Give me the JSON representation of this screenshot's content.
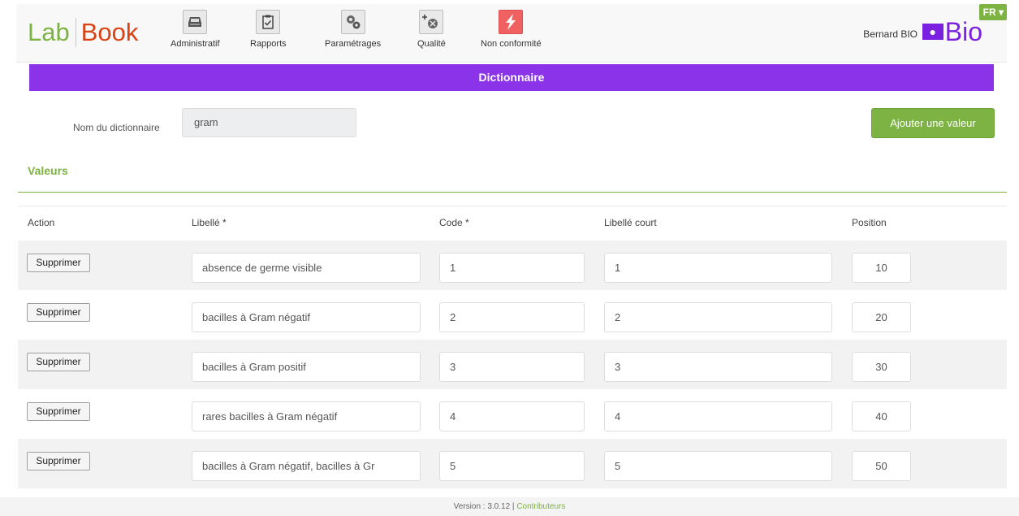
{
  "header": {
    "logo_left": "Lab",
    "logo_right": "Book",
    "nav": [
      {
        "label": "Administratif",
        "icon": "inbox-icon"
      },
      {
        "label": "Rapports",
        "icon": "clipboard-check-icon"
      },
      {
        "label": "Paramétrages",
        "icon": "gears-icon"
      },
      {
        "label": "Qualité",
        "icon": "quality-gear-icon"
      },
      {
        "label": "Non conformité",
        "icon": "lightning-icon"
      }
    ],
    "user_name": "Bernard BIO",
    "bio_logo_text": "Bio",
    "language": "FR"
  },
  "title_bar": "Dictionnaire",
  "form": {
    "dict_name_label": "Nom du dictionnaire",
    "dict_name_value": "gram",
    "add_button": "Ajouter une valeur",
    "section_title": "Valeurs"
  },
  "table": {
    "headers": {
      "action": "Action",
      "libelle": "Libellé *",
      "code": "Code *",
      "libelle_court": "Libellé court",
      "position": "Position"
    },
    "delete_label": "Supprimer",
    "rows": [
      {
        "libelle": "absence de germe visible",
        "code": "1",
        "court": "1",
        "position": "10"
      },
      {
        "libelle": "bacilles à Gram négatif",
        "code": "2",
        "court": "2",
        "position": "20"
      },
      {
        "libelle": "bacilles à Gram positif",
        "code": "3",
        "court": "3",
        "position": "30"
      },
      {
        "libelle": "rares bacilles à Gram négatif",
        "code": "4",
        "court": "4",
        "position": "40"
      },
      {
        "libelle": "bacilles à Gram négatif, bacilles à Gr",
        "code": "5",
        "court": "5",
        "position": "50"
      }
    ]
  },
  "footer": {
    "version": "Version : 3.0.12 | ",
    "link": "Contributeurs"
  },
  "colors": {
    "accent_green": "#7cb342",
    "purple": "#8b33e8",
    "brand_orange": "#d84315"
  }
}
